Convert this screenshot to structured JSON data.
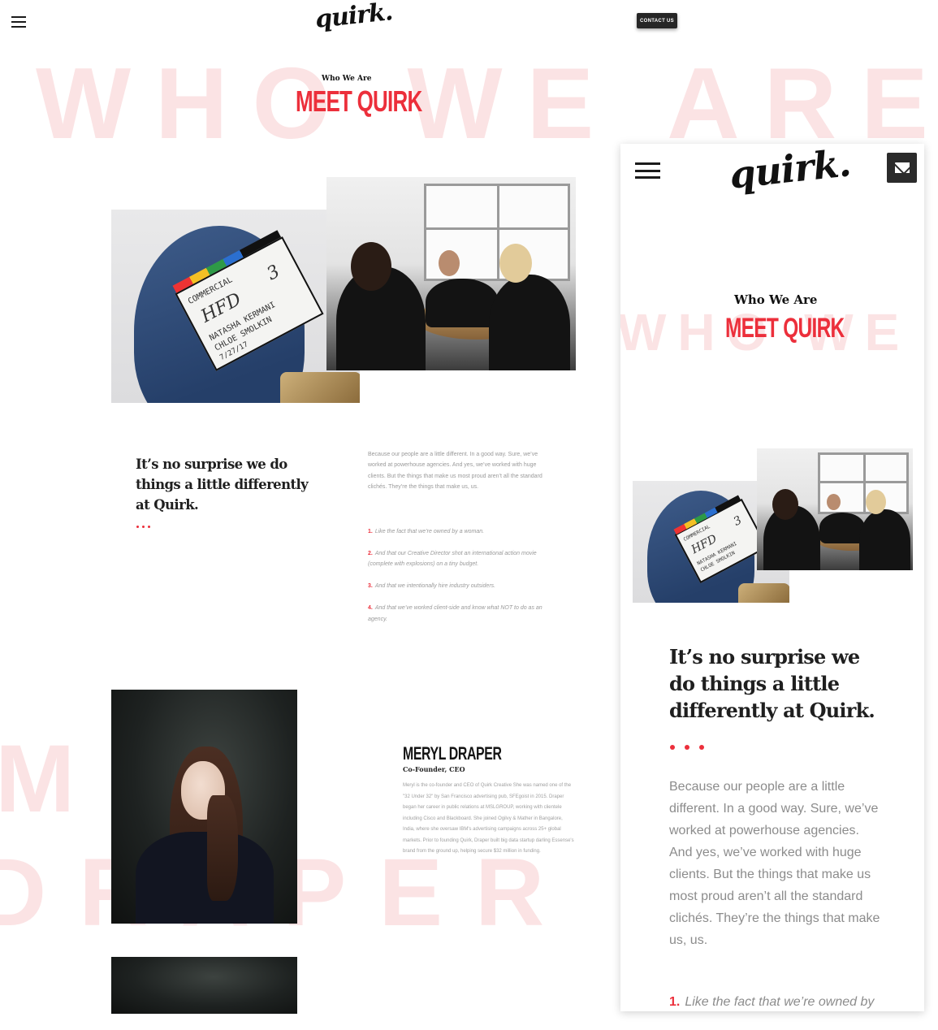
{
  "desktop": {
    "header": {
      "logo": "quirk.",
      "contact_label": "CONTACT US"
    },
    "hero": {
      "bg_word": "WHO WE ARE",
      "eyebrow": "Who We Are",
      "title": "MEET QUIRK"
    },
    "intro": {
      "headline": "It’s no surprise we do things a little differently at Quirk.",
      "body": "Because our people are a little different. In a good way. Sure, we’ve worked at powerhouse agencies. And yes, we’ve worked with huge clients. But the things that make us most proud aren’t all the standard clichés. They’re the things that make us, us.",
      "list": [
        {
          "num": "1.",
          "text": "Like the fact that we’re owned by a woman."
        },
        {
          "num": "2.",
          "text": "And that our Creative Director shot an international action movie (complete with explosions) on a tiny budget."
        },
        {
          "num": "3.",
          "text": "And that we intentionally hire industry outsiders."
        },
        {
          "num": "4.",
          "text": "And that we’ve worked client-side and know what NOT to do as an agency."
        }
      ]
    },
    "team": {
      "bg_word_1": "ME",
      "bg_word_2": "DRAPER",
      "name": "MERYL DRAPER",
      "role": "Co-Founder, CEO",
      "bio": "Meryl is the co-founder and CEO of Quirk Creative She was named one of the \"32 Under 32\" by San Francisco advertising pub, SFEgoist in 2015. Draper began her career in public relations at MSLGROUP, working with clientele including Cisco and Blackboard. She joined Ogilvy & Mather in Bangalore, India, where she oversaw IBM's advertising campaigns across 25+ global markets. Prior to founding Quirk, Draper built big data startup darling Essense's brand from the ground up, helping secure $32 million in funding."
    },
    "clapboard": {
      "title": "COMMERCIAL",
      "code": "HFD",
      "scene": "3",
      "director": "NATASHA KERMANI",
      "camera": "CHLOE SMOLKIN",
      "date": "7/27/17"
    }
  },
  "mobile": {
    "header": {
      "logo": "quirk."
    },
    "hero": {
      "bg_word": "WHO WE ARE",
      "eyebrow": "Who We Are",
      "title": "MEET QUIRK"
    },
    "intro": {
      "headline": "It’s no surprise we do things a little differently at Quirk.",
      "body": "Because our people are a little different. In a good way. Sure, we’ve worked at powerhouse agencies. And yes, we’ve worked with huge clients. But the things that make us most proud aren’t all the standard clichés. They’re the things that make us, us.",
      "list_first": {
        "num": "1.",
        "text": "Like the fact that we’re owned by"
      }
    }
  },
  "colors": {
    "accent": "#ec2f3b",
    "bg_word": "#fbe3e4",
    "dark": "#262626"
  },
  "icons": [
    "menu-icon",
    "mail-icon"
  ]
}
